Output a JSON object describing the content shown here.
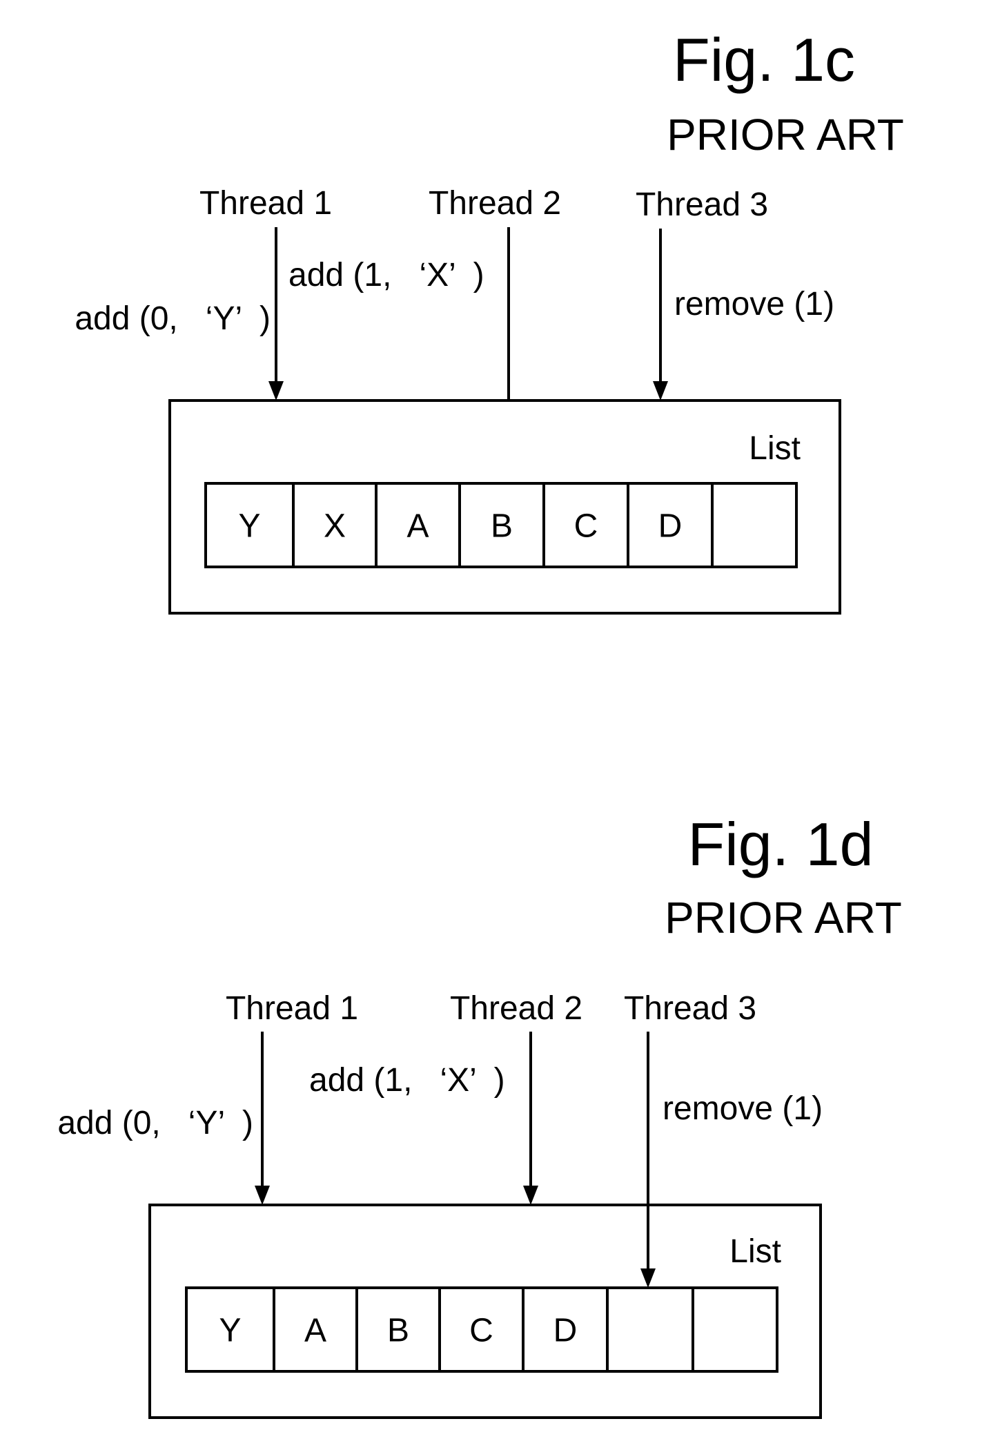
{
  "figures": [
    {
      "title": "Fig. 1c",
      "subtitle": "PRIOR ART",
      "list_label": "List",
      "threads": [
        {
          "label": "Thread 1",
          "operation": "add (0,   ‘Y’  )",
          "target": "list-top"
        },
        {
          "label": "Thread 2",
          "operation": "add (1,   ‘X’  )",
          "target": "cell-3"
        },
        {
          "label": "Thread 3",
          "operation": "remove (1)",
          "target": "list-top"
        }
      ],
      "cells": [
        "Y",
        "X",
        "A",
        "B",
        "C",
        "D",
        ""
      ]
    },
    {
      "title": "Fig. 1d",
      "subtitle": "PRIOR ART",
      "list_label": "List",
      "threads": [
        {
          "label": "Thread 1",
          "operation": "add (0,   ‘Y’  )",
          "target": "list-top"
        },
        {
          "label": "Thread 2",
          "operation": "add (1,   ‘X’  )",
          "target": "list-top"
        },
        {
          "label": "Thread 3",
          "operation": "remove (1)",
          "target": "cell-5"
        }
      ],
      "cells": [
        "Y",
        "A",
        "B",
        "C",
        "D",
        "",
        ""
      ]
    }
  ]
}
